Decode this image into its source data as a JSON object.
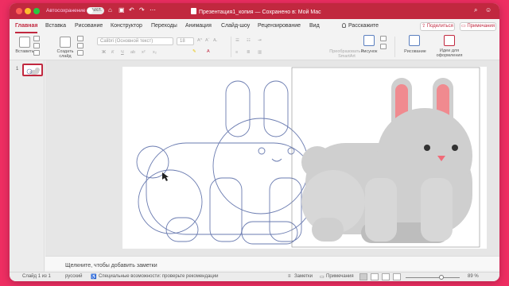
{
  "titlebar": {
    "autosave_label": "Автосохранение",
    "autosave_state": "ВЫКЛ.",
    "document_title": "Презентация1_копия — Сохранено в: Мой Mac"
  },
  "tabs": [
    {
      "label": "Главная"
    },
    {
      "label": "Вставка"
    },
    {
      "label": "Рисование"
    },
    {
      "label": "Конструктор"
    },
    {
      "label": "Переходы"
    },
    {
      "label": "Анимация"
    },
    {
      "label": "Слайд-шоу"
    },
    {
      "label": "Рецензирование"
    },
    {
      "label": "Вид"
    }
  ],
  "tell_me": "Расскажите",
  "share_label": "Поделиться",
  "comments_label": "Примечания",
  "ribbon": {
    "paste_label": "Вставить",
    "new_slide_label": "Создать слайд",
    "font_name": "Calibri (Основной текст)",
    "font_size": "18",
    "smartart_label": "Преобразовать в SmartArt",
    "picture_label": "Рисунок",
    "drawing_label": "Рисование",
    "design_ideas_label": "Идеи для оформления"
  },
  "slide_pane": {
    "slide_number": "1"
  },
  "notes_placeholder": "Щелкните, чтобы добавить заметки",
  "status": {
    "slide_info": "Слайд 1 из 1",
    "language": "русский",
    "accessibility": "Специальные возможности: проверьте рекомендации",
    "notes_btn": "Заметки",
    "comments_btn": "Примечания",
    "zoom": "89 %"
  },
  "colors": {
    "accent": "#c1283f",
    "background": "#ee2e62",
    "rabbit_body": "#cfcfcf",
    "ear_inner": "#f08a8f"
  }
}
